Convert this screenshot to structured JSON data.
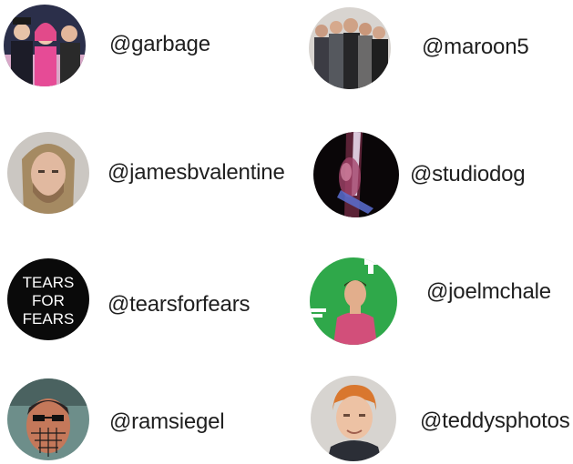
{
  "accounts": [
    {
      "handle": "@garbage",
      "avatar_icon": "band-photo-icon"
    },
    {
      "handle": "@maroon5",
      "avatar_icon": "band-photo-icon"
    },
    {
      "handle": "@jamesbvalentine",
      "avatar_icon": "portrait-photo-icon"
    },
    {
      "handle": "@studiodog",
      "avatar_icon": "abstract-photo-icon"
    },
    {
      "handle": "@tearsforfears",
      "avatar_icon": "text-logo-icon",
      "logo_text": [
        "TEARS",
        "FOR",
        "FEARS"
      ]
    },
    {
      "handle": "@joelmchale",
      "avatar_icon": "portrait-photo-icon"
    },
    {
      "handle": "@ramsiegel",
      "avatar_icon": "portrait-photo-icon"
    },
    {
      "handle": "@teddysphotos",
      "avatar_icon": "portrait-photo-icon"
    }
  ],
  "colors": {
    "text": "#1f1f1f",
    "joel_bg": "#2fa84a",
    "tears_bg": "#0a0a0a"
  }
}
